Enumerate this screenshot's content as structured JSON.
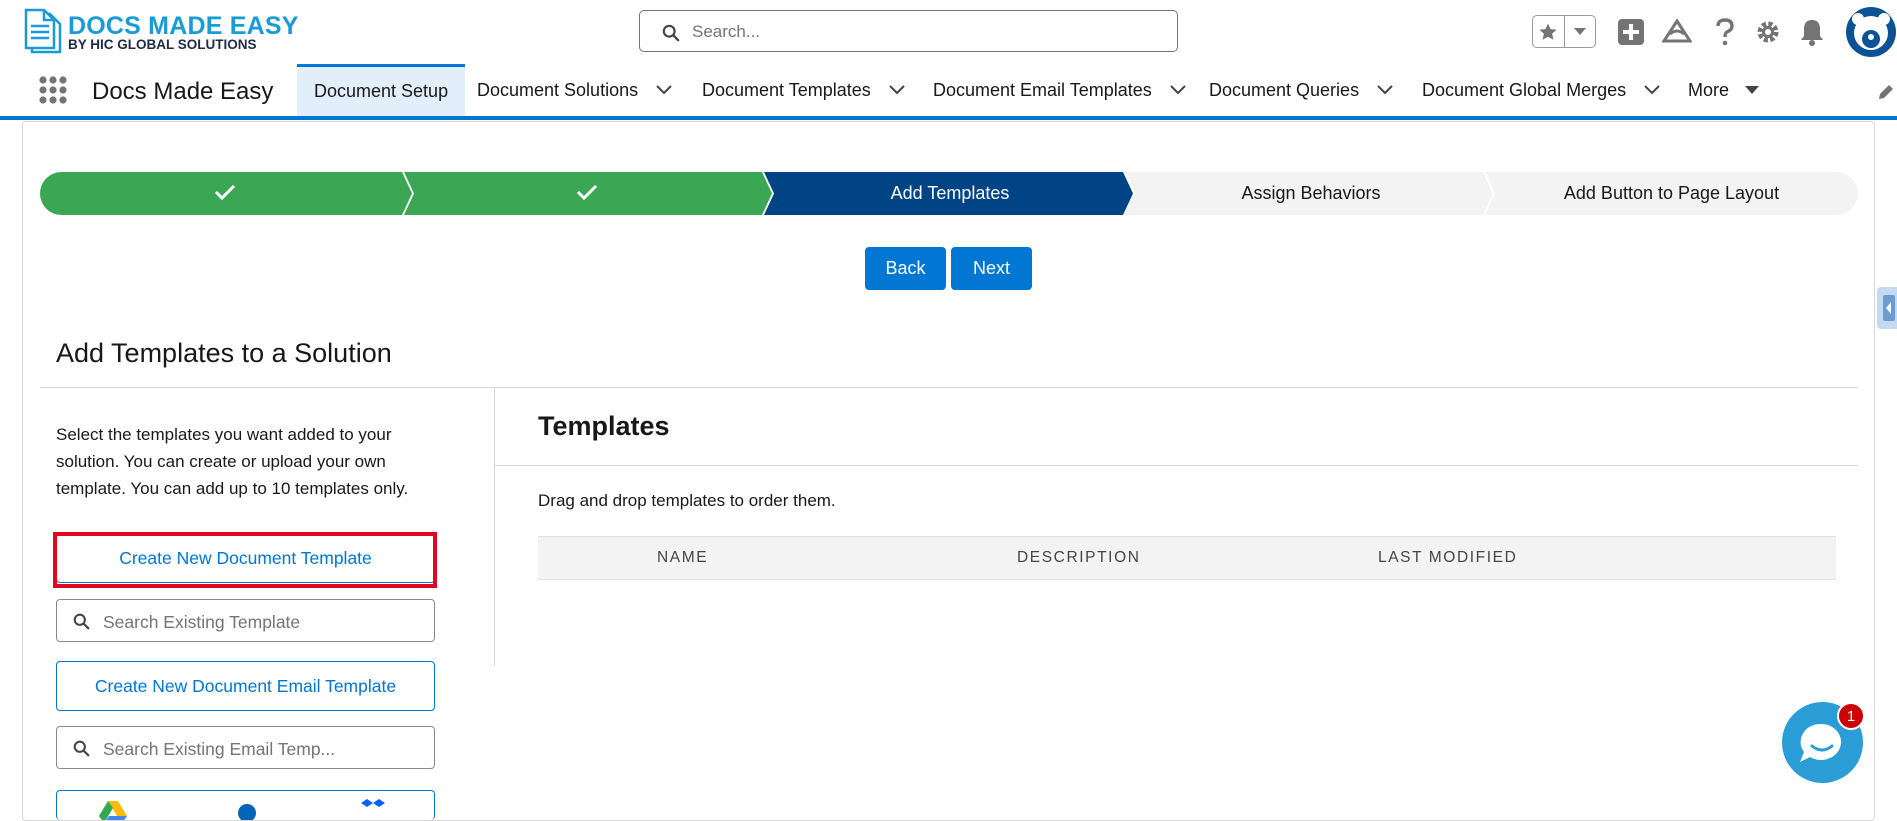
{
  "header": {
    "logo_title": "DOCS MADE EASY",
    "logo_subtitle": "BY HIC GLOBAL SOLUTIONS",
    "search_placeholder": "Search..."
  },
  "nav": {
    "app_name": "Docs Made Easy",
    "tabs": [
      {
        "label": "Document Setup",
        "active": true
      },
      {
        "label": "Document Solutions"
      },
      {
        "label": "Document Templates"
      },
      {
        "label": "Document Email Templates"
      },
      {
        "label": "Document Queries"
      },
      {
        "label": "Document Global Merges"
      },
      {
        "label": "More"
      }
    ]
  },
  "path": {
    "steps": [
      {
        "label": "",
        "state": "complete"
      },
      {
        "label": "",
        "state": "complete"
      },
      {
        "label": "Add Templates",
        "state": "current"
      },
      {
        "label": "Assign Behaviors",
        "state": "incomplete"
      },
      {
        "label": "Add Button to Page Layout",
        "state": "incomplete"
      }
    ]
  },
  "actions": {
    "back": "Back",
    "next": "Next"
  },
  "section": {
    "title": "Add Templates to a Solution",
    "description": "Select the templates you want added to your solution. You can create or upload your own template. You can add up to 10 templates only.",
    "create_template": "Create New Document Template",
    "search_template_placeholder": "Search Existing Template",
    "create_email_template": "Create New Document Email Template",
    "search_email_placeholder": "Search Existing Email Temp..."
  },
  "templates": {
    "title": "Templates",
    "hint": "Drag and drop templates to order them.",
    "columns": [
      "NAME",
      "DESCRIPTION",
      "LAST MODIFIED"
    ]
  },
  "chat": {
    "badge": "1"
  },
  "colors": {
    "brand": "#0176d3",
    "complete": "#3ba755",
    "current": "#014486",
    "incomplete": "#f3f3f3",
    "highlight": "#e3081e"
  }
}
